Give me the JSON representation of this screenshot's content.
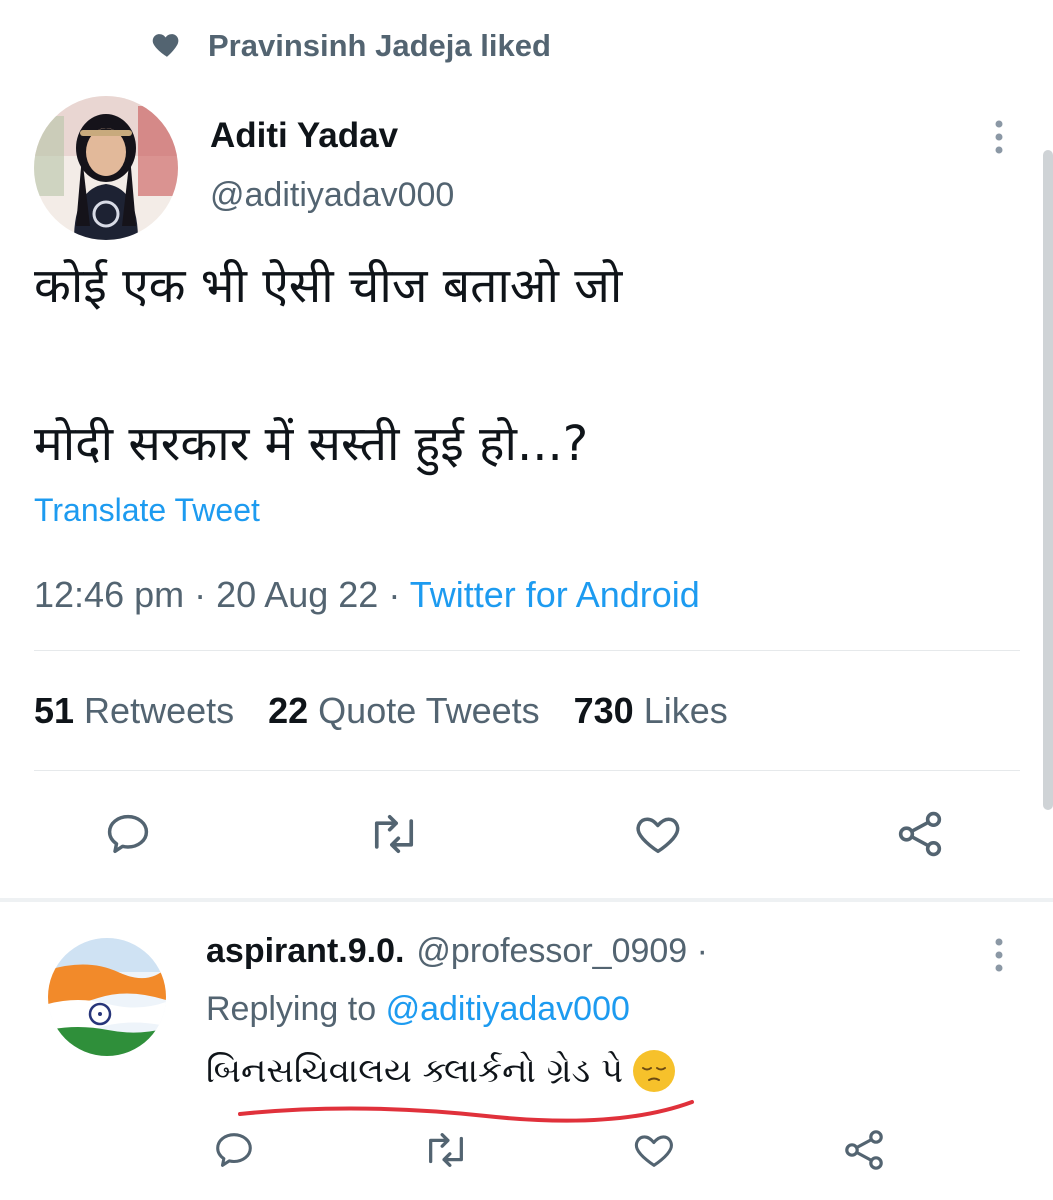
{
  "social_context": {
    "text": "Pravinsinh Jadeja liked"
  },
  "tweet": {
    "author_name": "Aditi Yadav",
    "author_handle": "@aditiyadav000",
    "text_line1": "कोई एक भी ऐसी चीज बताओ जो",
    "text_line2": "मोदी सरकार में सस्ती हुई हो...?",
    "translate_label": "Translate Tweet",
    "time": "12:46 pm",
    "date": "20 Aug 22",
    "source": "Twitter for Android",
    "separator": "·"
  },
  "stats": {
    "retweets_count": "51",
    "retweets_label": "Retweets",
    "quotes_count": "22",
    "quotes_label": "Quote Tweets",
    "likes_count": "730",
    "likes_label": "Likes"
  },
  "reply": {
    "author_name": "aspirant.9.0.",
    "author_handle": "@professor_0909 ·",
    "replying_prefix": "Replying to",
    "replying_handle": "@aditiyadav000",
    "text": "બિનસચિવાલય ક્લાર્કનો ગ્રેડ પે",
    "emoji": "pensive-face"
  },
  "colors": {
    "accent": "#1d9bf0",
    "secondary_text": "#536471",
    "primary_text": "#0f1419",
    "underline_mark": "#e0313b"
  }
}
